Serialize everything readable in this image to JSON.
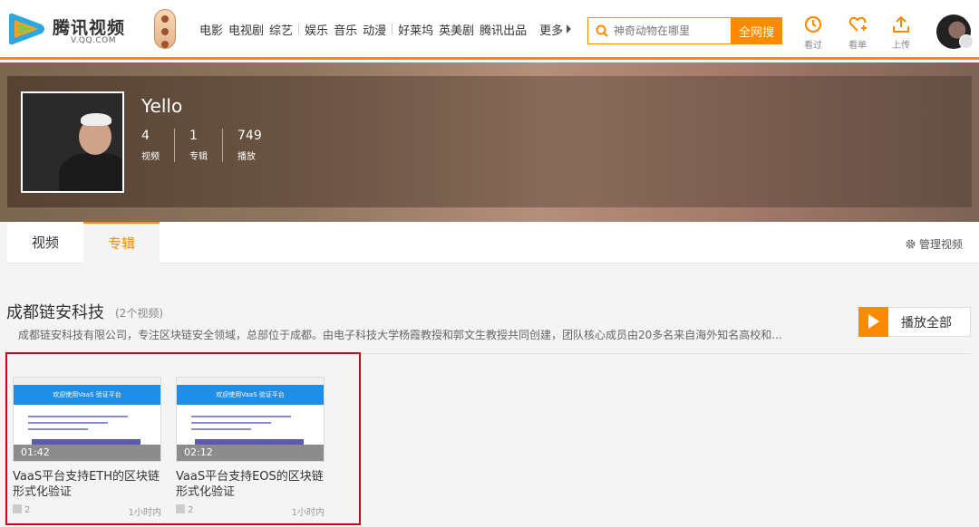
{
  "header": {
    "logo_text": "腾讯视频",
    "logo_sub": "V.QQ.COM",
    "nav": [
      "电影",
      "电视剧",
      "综艺",
      "娱乐",
      "音乐",
      "动漫",
      "好莱坞",
      "英美剧",
      "腾讯出品"
    ],
    "more_label": "更多",
    "search_placeholder": "神奇动物在哪里",
    "search_button": "全网搜",
    "tools": [
      {
        "label": "看过",
        "icon": "history-icon"
      },
      {
        "label": "看单",
        "icon": "heart-plus-icon"
      },
      {
        "label": "上传",
        "icon": "upload-icon"
      }
    ]
  },
  "profile": {
    "name": "Yello",
    "stats": [
      {
        "value": "4",
        "label": "视频"
      },
      {
        "value": "1",
        "label": "专辑"
      },
      {
        "value": "749",
        "label": "播放"
      }
    ]
  },
  "tabs": {
    "video": "视频",
    "album": "专辑",
    "manage": "管理视频"
  },
  "album": {
    "title": "成都链安科技",
    "count": "(2个视频)",
    "description": "成都链安科技有限公司，专注区块链安全领域，总部位于成都。由电子科技大学杨霞教授和郭文生教授共同创建，团队核心成员由20多名来自海外知名高校和...",
    "play_all": "播放全部",
    "videos": [
      {
        "thumb_banner": "欢迎使用VaaS 验证平台",
        "duration": "01:42",
        "title": "VaaS平台支持ETH的区块链形式化验证",
        "plays": "2",
        "time": "1小时内"
      },
      {
        "thumb_banner": "欢迎使用VaaS 验证平台",
        "duration": "02:12",
        "title": "VaaS平台支持EOS的区块链形式化验证",
        "plays": "2",
        "time": "1小时内"
      }
    ]
  },
  "colors": {
    "accent": "#ff8a00",
    "highlight_border": "#d0021b"
  }
}
